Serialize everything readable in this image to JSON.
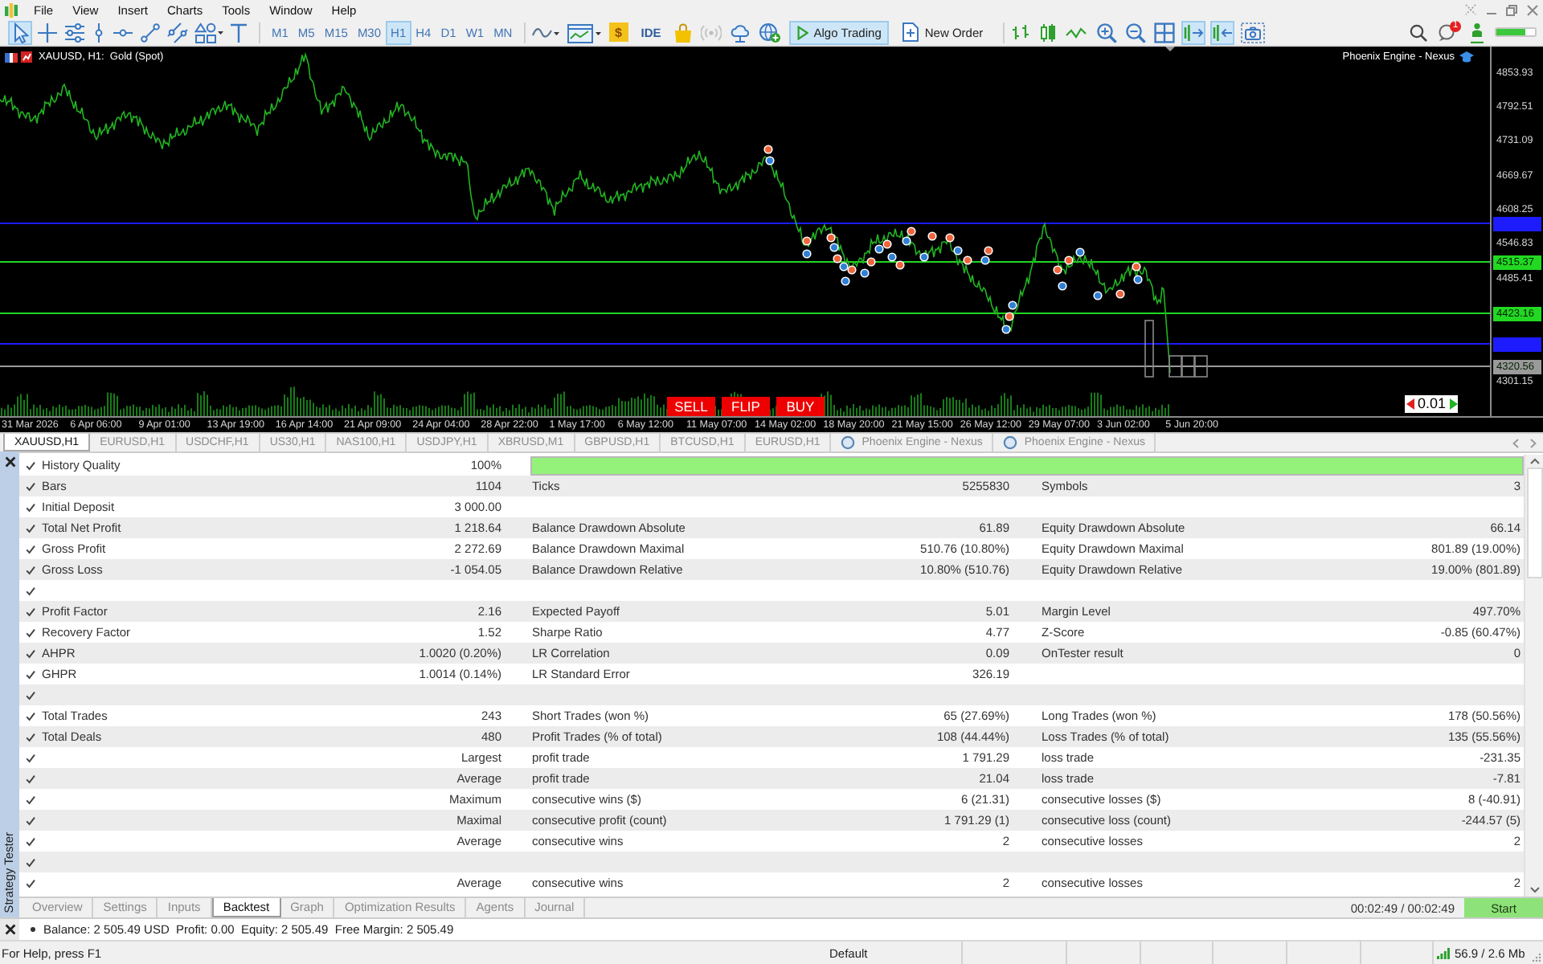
{
  "menu_bar": {
    "items": [
      "File",
      "View",
      "Insert",
      "Charts",
      "Tools",
      "Window",
      "Help"
    ]
  },
  "toolbar": {
    "drawing_tools": [
      {
        "selected": true
      },
      {
        "selected": false
      },
      {
        "selected": false
      },
      {
        "selected": false
      },
      {
        "selected": false
      },
      {
        "selected": false
      },
      {
        "selected": false
      },
      {
        "selected": false
      },
      {
        "selected": false
      }
    ],
    "timeframes": [
      {
        "label": "M1",
        "selected": false
      },
      {
        "label": "M5",
        "selected": false
      },
      {
        "label": "M15",
        "selected": false
      },
      {
        "label": "M30",
        "selected": false
      },
      {
        "label": "H1",
        "selected": true
      },
      {
        "label": "H4",
        "selected": false
      },
      {
        "label": "D1",
        "selected": false
      },
      {
        "label": "W1",
        "selected": false
      },
      {
        "label": "MN",
        "selected": false
      }
    ],
    "market_label": "$",
    "ide_label": "IDE",
    "algo_trading": {
      "label": "Algo Trading",
      "on": true
    },
    "new_order_label": "New Order",
    "chart_tools": [
      {
        "pressed": false
      },
      {
        "pressed": false
      },
      {
        "pressed": false
      },
      {
        "pressed": true
      },
      {
        "pressed": true
      },
      {
        "pressed": false
      }
    ],
    "notification_count": "1"
  },
  "chart": {
    "title": "XAUUSD, H1:  Gold (Spot)",
    "expert": "Phoenix Engine - Nexus",
    "price_labels": [
      "4853.93",
      "4792.51",
      "4731.09",
      "4669.67",
      "4608.25",
      "4546.83",
      "4485.41",
      "4301.15"
    ],
    "price_tags": [
      {
        "color": "#1c1cff"
      },
      {
        "text": "4515.37",
        "color": "#22d822"
      },
      {
        "text": "4423.16",
        "color": "#22d822"
      },
      {
        "color": "#1c1cff"
      },
      {
        "text": "4320.56",
        "color": "#9a9a9a"
      }
    ],
    "time_labels": [
      "31 Mar 2026",
      "6 Apr 06:00",
      "9 Apr 01:00",
      "13 Apr 19:00",
      "16 Apr 14:00",
      "21 Apr 09:00",
      "24 Apr 04:00",
      "28 Apr 22:00",
      "1 May 17:00",
      "6 May 12:00",
      "11 May 07:00",
      "14 May 02:00",
      "18 May 20:00",
      "21 May 15:00",
      "26 May 12:00",
      "29 May 07:00",
      "3 Jun 02:00",
      "5 Jun 20:00"
    ],
    "trade_buttons": [
      "SELL",
      "FLIP",
      "BUY"
    ],
    "lot": "0.01"
  },
  "chart_tabs": [
    {
      "label": "XAUUSD,H1",
      "kind": "symbol",
      "selected": true
    },
    {
      "label": "EURUSD,H1",
      "kind": "symbol",
      "selected": false
    },
    {
      "label": "USDCHF,H1",
      "kind": "symbol",
      "selected": false
    },
    {
      "label": "US30,H1",
      "kind": "symbol",
      "selected": false
    },
    {
      "label": "NAS100,H1",
      "kind": "symbol",
      "selected": false
    },
    {
      "label": "USDJPY,H1",
      "kind": "symbol",
      "selected": false
    },
    {
      "label": "XBRUSD,M1",
      "kind": "symbol",
      "selected": false
    },
    {
      "label": "GBPUSD,H1",
      "kind": "symbol",
      "selected": false
    },
    {
      "label": "BTCUSD,H1",
      "kind": "symbol",
      "selected": false
    },
    {
      "label": "EURUSD,H1",
      "kind": "symbol",
      "selected": false
    },
    {
      "label": "Phoenix Engine - Nexus",
      "kind": "app",
      "selected": false
    },
    {
      "label": "Phoenix Engine - Nexus",
      "kind": "app",
      "selected": false
    }
  ],
  "tester": {
    "panel_title": "Strategy Tester",
    "rows": [
      {
        "kind": "quality",
        "checked": true,
        "label_1": "History Quality",
        "value_1": "100%",
        "level": 1
      },
      {
        "kind": "stats",
        "checked": true,
        "label_1": "Bars",
        "value_1": "1104",
        "label_2": "Ticks",
        "value_2": "5255830",
        "label_3": "Symbols",
        "value_3": "3"
      },
      {
        "kind": "stats",
        "checked": true,
        "label_1": "Initial Deposit",
        "value_1": "3 000.00"
      },
      {
        "kind": "stats",
        "checked": true,
        "label_1": "Total Net Profit",
        "value_1": "1 218.64",
        "label_2": "Balance Drawdown Absolute",
        "value_2": "61.89",
        "label_3": "Equity Drawdown Absolute",
        "value_3": "66.14"
      },
      {
        "kind": "stats",
        "checked": true,
        "label_1": "Gross Profit",
        "value_1": "2 272.69",
        "label_2": "Balance Drawdown Maximal",
        "value_2": "510.76 (10.80%)",
        "label_3": "Equity Drawdown Maximal",
        "value_3": "801.89 (19.00%)"
      },
      {
        "kind": "stats",
        "checked": true,
        "label_1": "Gross Loss",
        "value_1": "-1 054.05",
        "label_2": "Balance Drawdown Relative",
        "value_2": "10.80% (510.76)",
        "label_3": "Equity Drawdown Relative",
        "value_3": "19.00% (801.89)"
      },
      {
        "kind": "stats",
        "checked": true
      },
      {
        "kind": "stats",
        "checked": true,
        "label_1": "Profit Factor",
        "value_1": "2.16",
        "label_2": "Expected Payoff",
        "value_2": "5.01",
        "label_3": "Margin Level",
        "value_3": "497.70%"
      },
      {
        "kind": "stats",
        "checked": true,
        "label_1": "Recovery Factor",
        "value_1": "1.52",
        "label_2": "Sharpe Ratio",
        "value_2": "4.77",
        "label_3": "Z-Score",
        "value_3": "-0.85 (60.47%)"
      },
      {
        "kind": "stats",
        "checked": true,
        "label_1": "AHPR",
        "value_1": "1.0020 (0.20%)",
        "label_2": "LR Correlation",
        "value_2": "0.09",
        "label_3": "OnTester result",
        "value_3": "0"
      },
      {
        "kind": "stats",
        "checked": true,
        "label_1": "GHPR",
        "value_1": "1.0014 (0.14%)",
        "label_2": "LR Standard Error",
        "value_2": "326.19"
      },
      {
        "kind": "stats",
        "checked": true
      },
      {
        "kind": "stats",
        "checked": true,
        "label_1": "Total Trades",
        "value_1": "243",
        "label_2": "Short Trades (won %)",
        "value_2": "65 (27.69%)",
        "label_3": "Long Trades (won %)",
        "value_3": "178 (50.56%)"
      },
      {
        "kind": "stats",
        "checked": true,
        "label_1": "Total Deals",
        "value_1": "480",
        "label_2": "Profit Trades (% of total)",
        "value_2": "108 (44.44%)",
        "label_3": "Loss Trades (% of total)",
        "value_3": "135 (55.56%)"
      },
      {
        "kind": "stats",
        "checked": true,
        "value_1": "Largest",
        "label_2": "profit trade",
        "value_2": "1 791.29",
        "label_3": "loss trade",
        "value_3": "-231.35"
      },
      {
        "kind": "stats",
        "checked": true,
        "value_1": "Average",
        "label_2": "profit trade",
        "value_2": "21.04",
        "label_3": "loss trade",
        "value_3": "-7.81"
      },
      {
        "kind": "stats",
        "checked": true,
        "value_1": "Maximum",
        "label_2": "consecutive wins ($)",
        "value_2": "6 (21.31)",
        "label_3": "consecutive losses ($)",
        "value_3": "8 (-40.91)"
      },
      {
        "kind": "stats",
        "checked": true,
        "value_1": "Maximal",
        "label_2": "consecutive profit (count)",
        "value_2": "1 791.29 (1)",
        "label_3": "consecutive loss (count)",
        "value_3": "-244.57 (5)"
      },
      {
        "kind": "stats",
        "checked": true,
        "value_1": "Average",
        "label_2": "consecutive wins",
        "value_2": "2",
        "label_3": "consecutive losses",
        "value_3": "2"
      },
      {
        "kind": "stats",
        "checked": true
      },
      {
        "kind": "stats",
        "checked": true,
        "value_1": "Average",
        "label_2": "consecutive wins",
        "value_2": "2",
        "label_3": "consecutive losses",
        "value_3": "2"
      }
    ],
    "tabs": [
      {
        "label": "Overview",
        "selected": false
      },
      {
        "label": "Settings",
        "selected": false
      },
      {
        "label": "Inputs",
        "selected": false
      },
      {
        "label": "Backtest",
        "selected": true
      },
      {
        "label": "Graph",
        "selected": false
      },
      {
        "label": "Optimization Results",
        "selected": false
      },
      {
        "label": "Agents",
        "selected": false
      },
      {
        "label": "Journal",
        "selected": false
      }
    ],
    "elapsed": "00:02:49 / 00:02:49",
    "start_label": "Start"
  },
  "toolbox": {
    "account": "Balance: 2 505.49 USD  Profit: 0.00  Equity: 2 505.49  Free Margin: 2 505.49"
  },
  "status_bar": {
    "help": "For Help, press F1",
    "profile": "Default",
    "traffic": "56.9 / 2.6 Mb"
  }
}
